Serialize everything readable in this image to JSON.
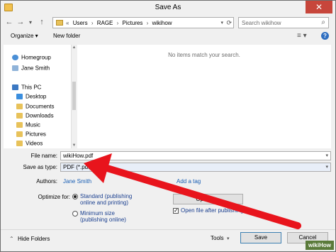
{
  "window": {
    "title": "Save As",
    "close_glyph": "✕"
  },
  "address": {
    "back": "←",
    "forward": "→",
    "up_dd": "▾",
    "up": "↑",
    "crumbs": [
      "«",
      "Users",
      "›",
      "RAGE",
      "›",
      "Pictures",
      "›",
      "wikihow"
    ],
    "dropdown": "▾",
    "refresh": "⟳",
    "search_placeholder": "Search wikihow",
    "search_icon": "⌕"
  },
  "toolbar": {
    "organize": "Organize ▾",
    "new_folder": "New folder",
    "view_icon": "≡ ▾",
    "help_icon": "?"
  },
  "nav": {
    "items": [
      {
        "label": "Homegroup",
        "icon": "homegroup-icon",
        "color": "#4a8fd6"
      },
      {
        "label": "Jane Smith",
        "icon": "user-icon",
        "color": "#8fb3d9"
      },
      {
        "label": "This PC",
        "icon": "computer-icon",
        "color": "#3b78c2"
      },
      {
        "label": "Desktop",
        "icon": "desktop-icon",
        "color": "#3b8ede"
      },
      {
        "label": "Documents",
        "icon": "documents-icon",
        "color": "#e8c25a"
      },
      {
        "label": "Downloads",
        "icon": "downloads-icon",
        "color": "#e8c25a"
      },
      {
        "label": "Music",
        "icon": "music-icon",
        "color": "#e8c25a"
      },
      {
        "label": "Pictures",
        "icon": "pictures-icon",
        "color": "#e8c25a"
      },
      {
        "label": "Videos",
        "icon": "videos-icon",
        "color": "#e8c25a"
      }
    ]
  },
  "content": {
    "empty_message": "No items match your search."
  },
  "form": {
    "file_name_label": "File name:",
    "file_name_value": "wikiHow.pdf",
    "save_type_label": "Save as type:",
    "save_type_value": "PDF (*.pdf)",
    "authors_label": "Authors:",
    "authors_value": "Jane Smith",
    "tags_label": "Tags:",
    "tags_value": "Add a tag",
    "optimize_label": "Optimize for:",
    "opt_standard": "Standard (publishing online and printing)",
    "opt_minimum": "Minimum size (publishing online)",
    "options_button": "Options...",
    "open_after_label": "Open file after publishing",
    "check_glyph": "✓",
    "hide_folders": "Hide Folders",
    "hide_icon": "⌃",
    "tools": "Tools",
    "tools_dd": "▾",
    "save": "Save",
    "cancel": "Cancel",
    "dd": "▾"
  },
  "watermark": "wikiHow",
  "colors": {
    "arrow": "#e8141c",
    "link": "#1a5fb4"
  }
}
